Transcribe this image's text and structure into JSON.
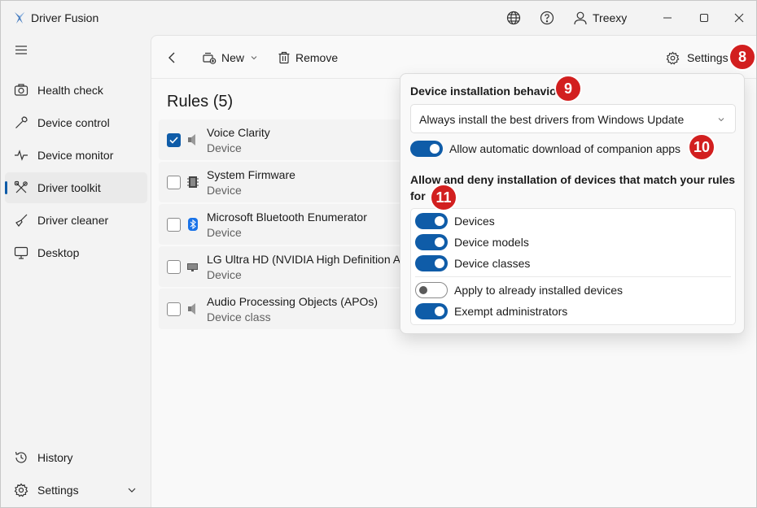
{
  "app": {
    "title": "Driver Fusion",
    "user": "Treexy"
  },
  "sidebar": {
    "items": [
      {
        "label": "Health check"
      },
      {
        "label": "Device control"
      },
      {
        "label": "Device monitor"
      },
      {
        "label": "Driver toolkit"
      },
      {
        "label": "Driver cleaner"
      },
      {
        "label": "Desktop"
      }
    ],
    "footer": [
      {
        "label": "History"
      },
      {
        "label": "Settings"
      }
    ]
  },
  "toolbar": {
    "new_label": "New",
    "remove_label": "Remove",
    "settings_label": "Settings"
  },
  "rules": {
    "title": "Rules (5)",
    "items": [
      {
        "name": "Voice Clarity",
        "type": "Device",
        "checked": true
      },
      {
        "name": "System Firmware",
        "type": "Device",
        "checked": false
      },
      {
        "name": "Microsoft Bluetooth Enumerator",
        "type": "Device",
        "checked": false
      },
      {
        "name": "LG Ultra HD (NVIDIA High Definition A",
        "type": "Device",
        "checked": false
      },
      {
        "name": "Audio Processing Objects (APOs)",
        "type": "Device class",
        "checked": false
      }
    ]
  },
  "flyout": {
    "behavior_heading": "Device installation behavior",
    "behavior_value": "Always install the best drivers from Windows Update",
    "companion_label": "Allow automatic download of companion apps",
    "companion_on": true,
    "match_heading_line1": "Allow and deny installation of devices that match your rules",
    "match_heading_line2": "for",
    "toggles": [
      {
        "label": "Devices",
        "on": true
      },
      {
        "label": "Device models",
        "on": true
      },
      {
        "label": "Device classes",
        "on": true
      },
      {
        "label": "Apply to already installed devices",
        "on": false
      },
      {
        "label": "Exempt administrators",
        "on": true
      }
    ]
  },
  "callouts": {
    "settings": "8",
    "behavior": "9",
    "companion": "10",
    "match": "11"
  },
  "colors": {
    "accent": "#0f5ca8",
    "badge": "#d21f1f"
  }
}
